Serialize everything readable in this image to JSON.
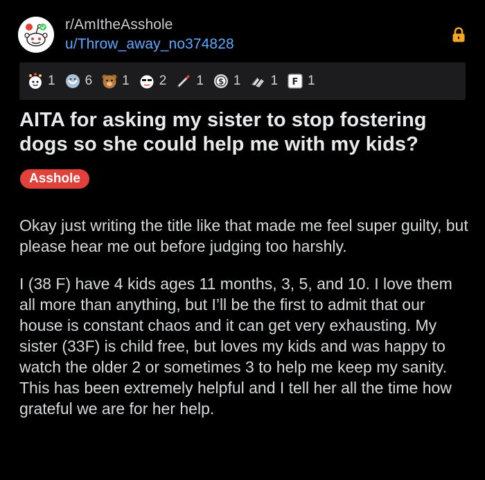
{
  "post": {
    "subreddit": "r/AmItheAsshole",
    "author": "u/Throw_away_no374828",
    "title": "AITA for asking my sister to stop fostering dogs so she could help me with my kids?",
    "flair": "Asshole",
    "flair_color": "#e0413a",
    "accent_link_color": "#5ea8ff",
    "lock_color": "#f6a623",
    "paragraphs": [
      "Okay just writing the title like that made me feel super guilty, but please hear me out before judging too harshly.",
      "I (38 F) have 4 kids ages 11 months, 3, 5, and 10. I love them all more than anything, but I’ll be the first to admit that our house is constant chaos and it can get very exhausting. My sister (33F) is child free, but loves my kids and was happy to watch the older 2 or sometimes 3 to help me keep my sanity. This has been extremely helpful and I tell her all the time how grateful we are for her help."
    ]
  },
  "awards": [
    {
      "icon": "wholesome-award-icon",
      "count": "1"
    },
    {
      "icon": "hugz-award-icon",
      "count": "6"
    },
    {
      "icon": "bear-award-icon",
      "count": "1"
    },
    {
      "icon": "face-award-icon",
      "count": "2"
    },
    {
      "icon": "pencil-award-icon",
      "count": "1"
    },
    {
      "icon": "coin-award-icon",
      "count": "1"
    },
    {
      "icon": "hands-award-icon",
      "count": "1"
    },
    {
      "icon": "press-f-award-icon",
      "count": "1"
    }
  ]
}
